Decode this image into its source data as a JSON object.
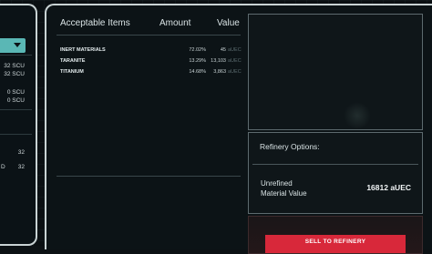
{
  "table": {
    "headers": [
      "Acceptable Items",
      "Amount",
      "Value"
    ],
    "rows": [
      {
        "name": "INERT MATERIALS",
        "pct": "72.02%",
        "qty": "45",
        "unit": "aUEC"
      },
      {
        "name": "TARANITE",
        "pct": "13.29%",
        "qty": "13,103",
        "unit": "aUEC"
      },
      {
        "name": "TITANIUM",
        "pct": "14.68%",
        "qty": "3,863",
        "unit": "aUEC"
      }
    ]
  },
  "left_panel": {
    "values": [
      "32 SCU",
      "32 SCU",
      "0 SCU",
      "0 SCU",
      "32",
      "32",
      "D"
    ]
  },
  "refinery": {
    "options_title": "Refinery Options:",
    "label": "Unrefined\nMaterial Value",
    "label_line1": "Unrefined",
    "label_line2": "Material Value",
    "value": "16812 aUEC"
  },
  "sell_button": {
    "label": "SELL TO REFINERY"
  },
  "colors": {
    "accent": "#5ab7b5",
    "sell": "#d8283a",
    "border": "#c9d3d4"
  }
}
